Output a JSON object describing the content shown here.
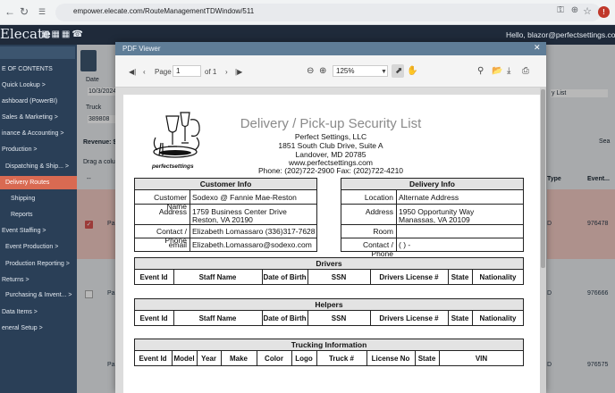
{
  "browser": {
    "url": "empower.elecate.com/RouteManagementTDWindow/511"
  },
  "app": {
    "logo": "Elecate",
    "greeting": "Hello, blazor@perfectsettings.com!",
    "sidebar": [
      {
        "label": "E OF CONTENTS",
        "active": false
      },
      {
        "label": "Quick Lookup  >",
        "active": false
      },
      {
        "label": "ashboard (PowerBI)",
        "active": false
      },
      {
        "label": "Sales & Marketing  >",
        "active": false
      },
      {
        "label": "inance & Accounting  >",
        "active": false
      },
      {
        "label": "Production  >",
        "active": false
      },
      {
        "label": "Dispatching & Ship...  >",
        "active": false
      },
      {
        "label": "Delivery Routes",
        "active": true
      },
      {
        "label": "Shipping",
        "active": false
      },
      {
        "label": "Reports",
        "active": false
      },
      {
        "label": "Event Staffing  >",
        "active": false
      },
      {
        "label": "Event Production  >",
        "active": false
      },
      {
        "label": "Production Reporting  >",
        "active": false
      },
      {
        "label": "Returns  >",
        "active": false
      },
      {
        "label": "Purchasing & Invent...  >",
        "active": false
      },
      {
        "label": "Data Items  >",
        "active": false
      },
      {
        "label": "eneral Setup  >",
        "active": false
      }
    ],
    "bg": {
      "date_label": "Date",
      "date_value": "10/3/2024",
      "truck_label": "Truck",
      "truck_value": "389808",
      "revenue": "Revenue: $5",
      "drag": "Drag a colum",
      "dash": "--",
      "list": "y List",
      "search": "Sea",
      "col_type": "Type",
      "col_event": "Event...",
      "rows": [
        {
          "pa": "Pa",
          "d": "D",
          "num": "976478"
        },
        {
          "pa": "Pa",
          "d": "D",
          "num": "976666"
        },
        {
          "pa": "Pa",
          "d": "D",
          "num": "976575"
        }
      ]
    }
  },
  "viewer": {
    "title": "PDF Viewer",
    "page_label": "Page",
    "page_value": "1",
    "page_of": "of 1",
    "zoom": "125%"
  },
  "doc": {
    "title": "Delivery / Pick-up Security List",
    "company": "Perfect Settings, LLC",
    "addr1": "1851 South Club Drive, Suite A",
    "addr2": "Landover, MD  20785",
    "web": "www.perfectsettings.com",
    "phone": "Phone: (202)722-2900 Fax: (202)722-4210",
    "logo_text": "perfectsettings",
    "customer": {
      "head": "Customer Info",
      "name_l": "Customer Name",
      "name_v": "Sodexo @ Fannie Mae-Reston",
      "addr_l": "Address",
      "addr_v1": "1759 Business Center Drive",
      "addr_v2": "Reston, VA   20190",
      "contact_l": "Contact / Phone",
      "contact_v": "Elizabeth Lomassaro (336)317-7628",
      "email_l": "email",
      "email_v": "Elizabeth.Lomassaro@sodexo.com"
    },
    "delivery": {
      "head": "Delivery Info",
      "loc_l": "Location",
      "loc_v": "Alternate Address",
      "addr_l": "Address",
      "addr_v1": "1950 Opportunity Way",
      "addr_v2": "Manassas, VA   20109",
      "room_l": "Room",
      "room_v": "",
      "contact_l": "Contact / Phone",
      "contact_v": "(   )   -"
    },
    "drivers": {
      "head": "Drivers",
      "cols": [
        "Event Id",
        "Staff Name",
        "Date of Birth",
        "SSN",
        "Drivers License #",
        "State",
        "Nationality"
      ]
    },
    "helpers": {
      "head": "Helpers",
      "cols": [
        "Event Id",
        "Staff Name",
        "Date of Birth",
        "SSN",
        "Drivers License #",
        "State",
        "Nationality"
      ]
    },
    "trucking": {
      "head": "Trucking Information",
      "cols": [
        "Event Id",
        "Model",
        "Year",
        "Make",
        "Color",
        "Logo",
        "Truck #",
        "License No",
        "State",
        "VIN"
      ]
    }
  },
  "colors": {
    "header": "#1f2a3a",
    "sidebar": "#2a3f57",
    "active": "#d96a52",
    "viewer_bar": "#5f7d97"
  }
}
